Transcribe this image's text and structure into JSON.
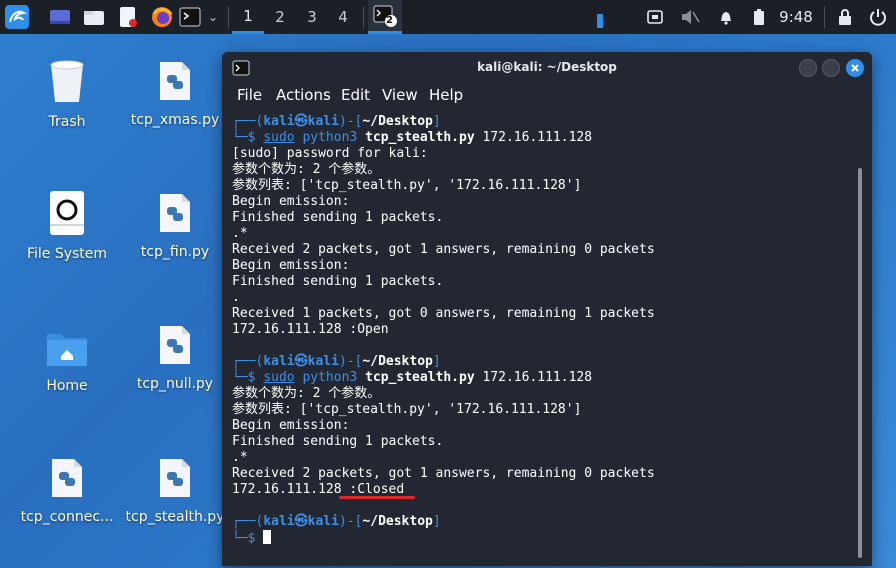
{
  "taskbar": {
    "workspaces": [
      "1",
      "2",
      "3",
      "4"
    ],
    "terminal_badge": "2",
    "clock": "9:48"
  },
  "desktop": {
    "icons": [
      {
        "label": "Trash",
        "icon": "trash-icon"
      },
      {
        "label": "tcp_xmas.py",
        "icon": "python-file-icon"
      },
      {
        "label": "File System",
        "icon": "drive-icon"
      },
      {
        "label": "tcp_fin.py",
        "icon": "python-file-icon"
      },
      {
        "label": "Home",
        "icon": "home-folder-icon"
      },
      {
        "label": "tcp_null.py",
        "icon": "python-file-icon"
      },
      {
        "label": "tcp_connec...",
        "icon": "python-file-icon"
      },
      {
        "label": "tcp_stealth.py",
        "icon": "python-file-icon"
      }
    ]
  },
  "window": {
    "title": "kali@kali: ~/Desktop",
    "menu": [
      "File",
      "Actions",
      "Edit",
      "View",
      "Help"
    ]
  },
  "terminal": {
    "prompt_corner_top": "┌──(",
    "prompt_user": "kali㉿kali",
    "prompt_mid": ")-[",
    "prompt_dir": "~/Desktop",
    "prompt_close": "]",
    "prompt_corner_bottom": "└─$ ",
    "cmd_sudo": "sudo",
    "cmd_python": " python3 ",
    "cmd_script": "tcp_stealth.py",
    "cmd_arg": " 172.16.111.128",
    "block1": [
      "[sudo] password for kali:",
      "参数个数为: 2 个参数。",
      "参数列表: ['tcp_stealth.py', '172.16.111.128']",
      "Begin emission:",
      "Finished sending 1 packets.",
      ".*",
      "Received 2 packets, got 1 answers, remaining 0 packets",
      "Begin emission:",
      "Finished sending 1 packets.",
      ".",
      "Received 1 packets, got 0 answers, remaining 1 packets",
      "172.16.111.128 :Open"
    ],
    "block2": [
      "参数个数为: 2 个参数。",
      "参数列表: ['tcp_stealth.py', '172.16.111.128']",
      "Begin emission:",
      "Finished sending 1 packets.",
      ".*",
      "Received 2 packets, got 1 answers, remaining 0 packets",
      "172.16.111.128 :Closed"
    ]
  },
  "colors": {
    "accent": "#3d8fe8",
    "annotation": "#e0262b",
    "terminal_bg": "#222731"
  }
}
